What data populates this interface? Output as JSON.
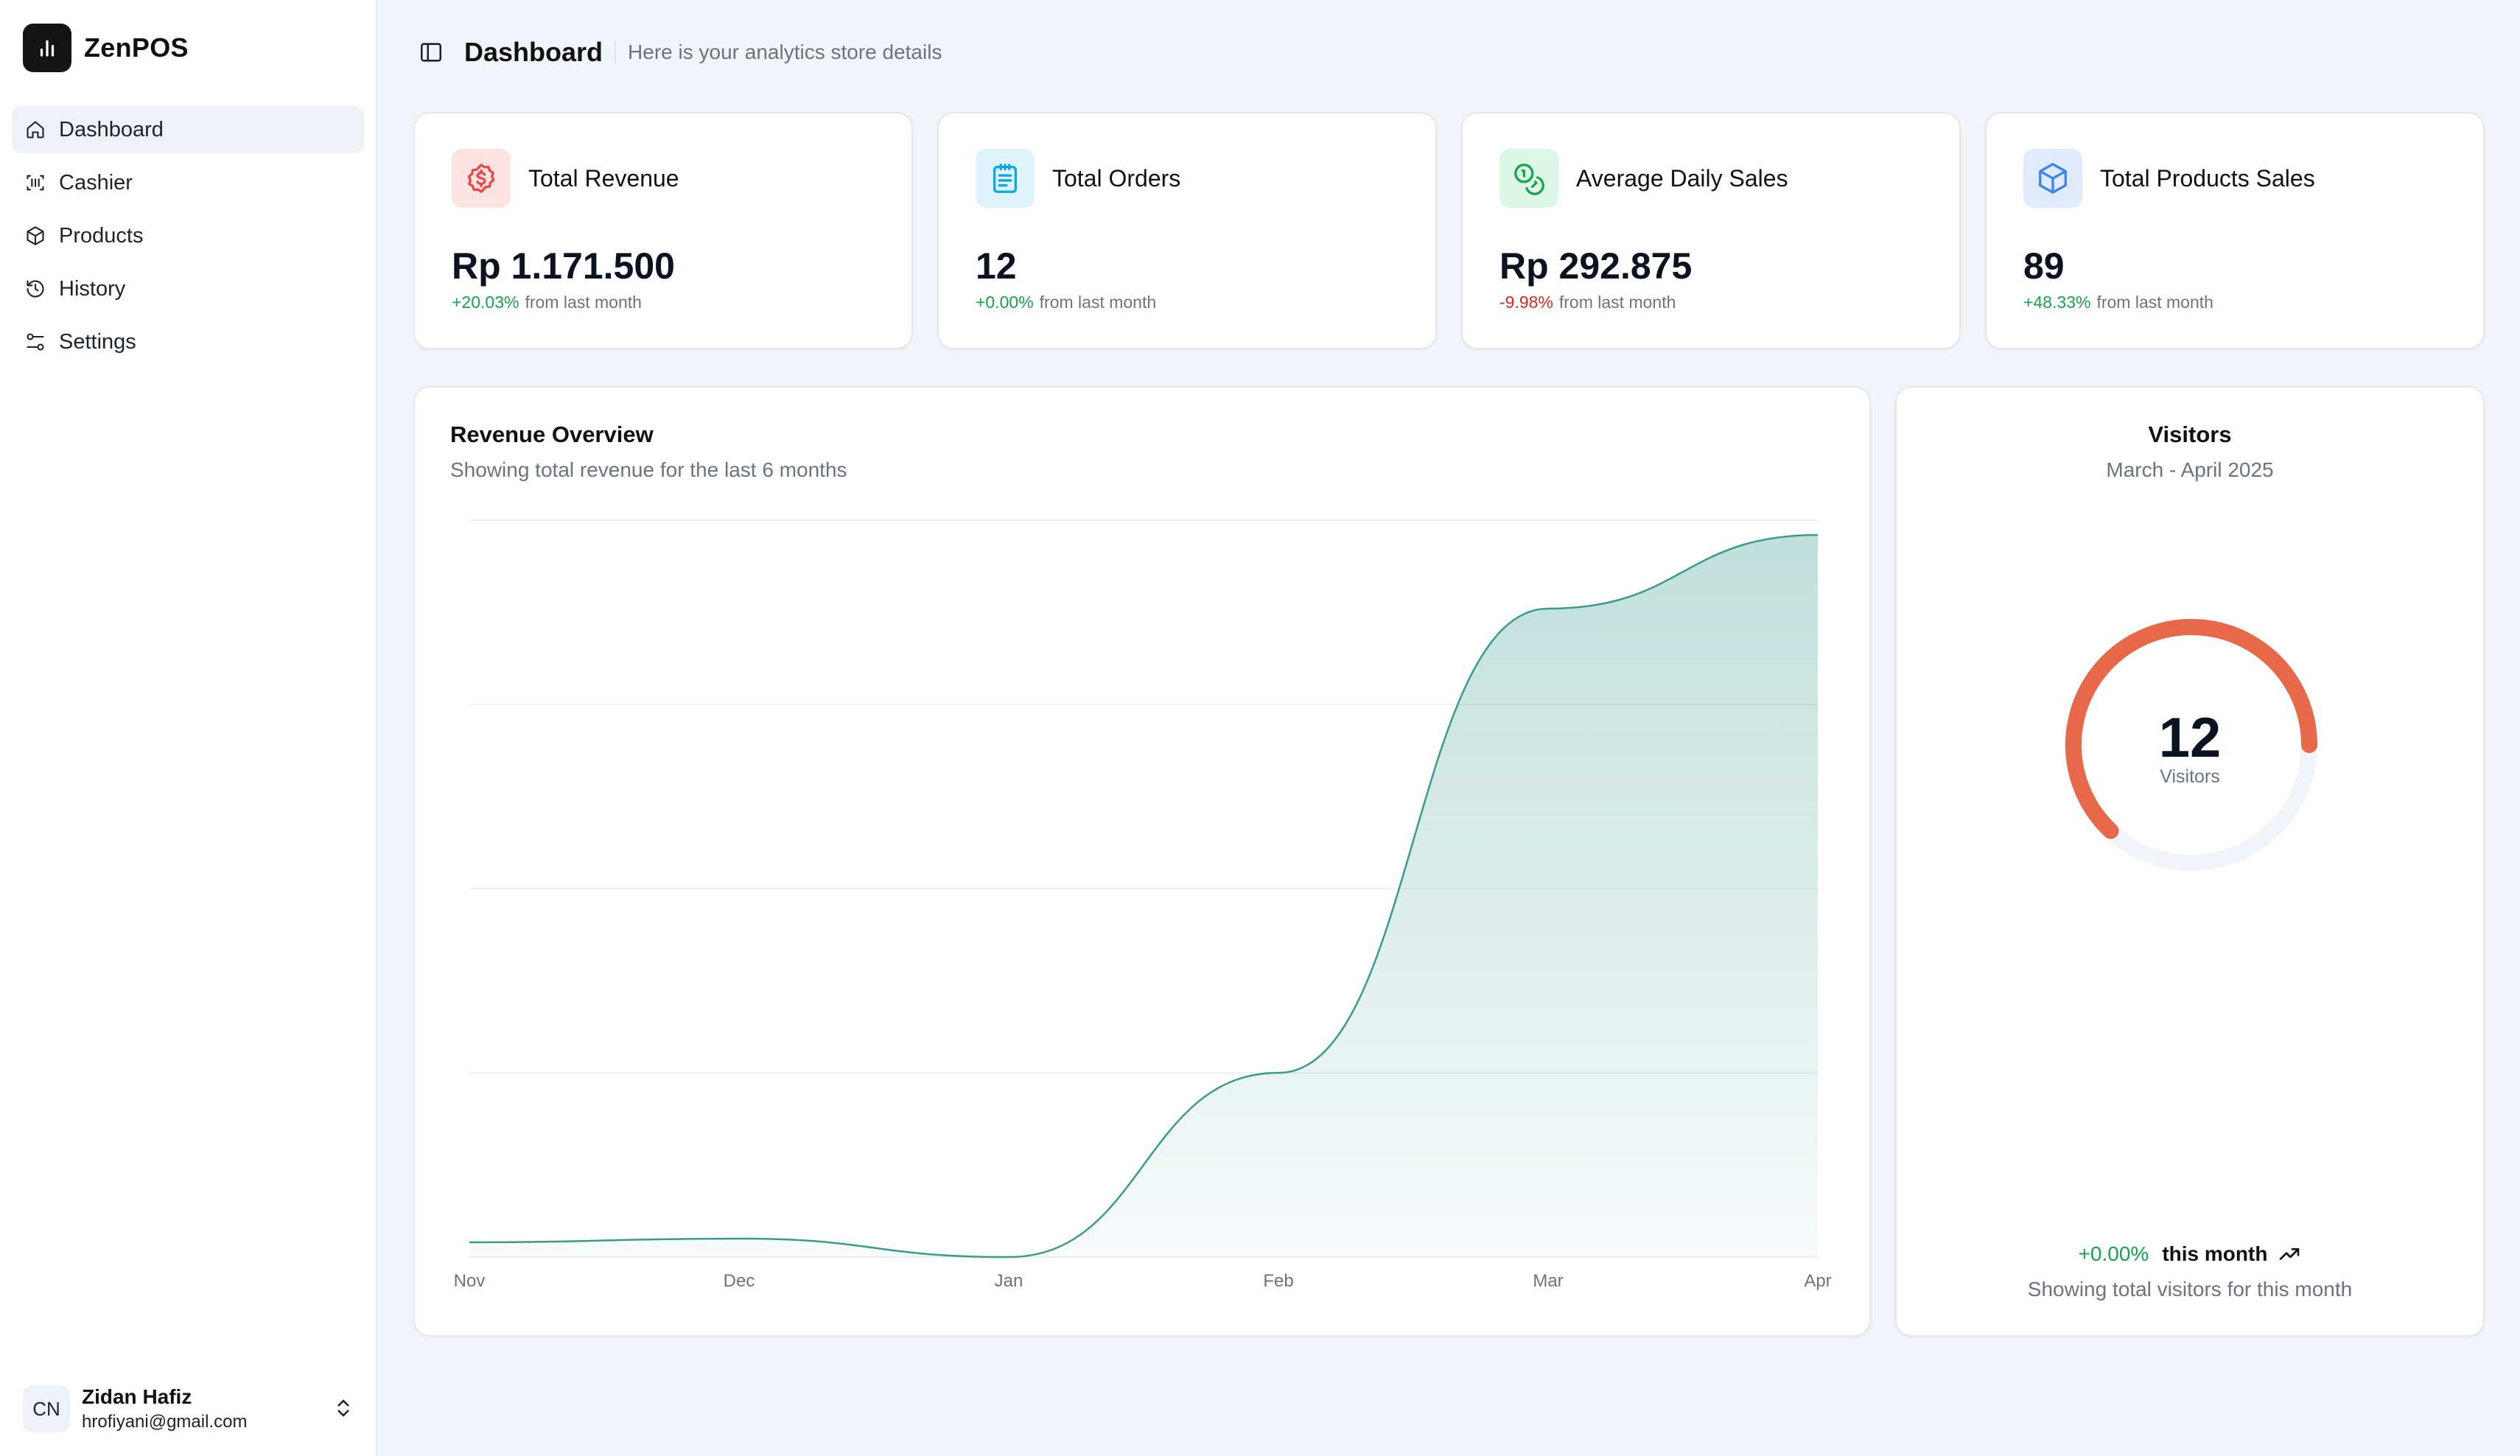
{
  "app": {
    "name": "ZenPOS"
  },
  "sidebar": {
    "items": [
      {
        "label": "Dashboard",
        "icon": "home-icon",
        "active": true
      },
      {
        "label": "Cashier",
        "icon": "scan-icon",
        "active": false
      },
      {
        "label": "Products",
        "icon": "box-icon",
        "active": false
      },
      {
        "label": "History",
        "icon": "history-icon",
        "active": false
      },
      {
        "label": "Settings",
        "icon": "sliders-icon",
        "active": false
      }
    ]
  },
  "user": {
    "initials": "CN",
    "name": "Zidan Hafiz",
    "email": "hrofiyani@gmail.com"
  },
  "header": {
    "title": "Dashboard",
    "subtitle": "Here is your analytics store details"
  },
  "stats": [
    {
      "label": "Total Revenue",
      "value": "Rp 1.171.500",
      "delta": "+20.03%",
      "delta_suffix": "from last month",
      "trend": "up",
      "icon": "dollar-badge-icon",
      "icon_color": "#ef4444",
      "icon_bg": "#fde2e2"
    },
    {
      "label": "Total Orders",
      "value": "12",
      "delta": "+0.00%",
      "delta_suffix": "from last month",
      "trend": "up",
      "icon": "clipboard-list-icon",
      "icon_color": "#0ea5e9",
      "icon_bg": "#dff3fc"
    },
    {
      "label": "Average Daily Sales",
      "value": "Rp 292.875",
      "delta": "-9.98%",
      "delta_suffix": "from last month",
      "trend": "down",
      "icon": "coins-icon",
      "icon_color": "#16a34a",
      "icon_bg": "#dcf7e6"
    },
    {
      "label": "Total Products Sales",
      "value": "89",
      "delta": "+48.33%",
      "delta_suffix": "from last month",
      "trend": "up",
      "icon": "box-icon",
      "icon_color": "#3b82f6",
      "icon_bg": "#e0ebfd"
    }
  ],
  "revenue": {
    "title": "Revenue Overview",
    "subtitle": "Showing total revenue for the last 6 months"
  },
  "chart_data": {
    "type": "area",
    "categories": [
      "Nov",
      "Dec",
      "Jan",
      "Feb",
      "Mar",
      "Apr"
    ],
    "values": [
      0.02,
      0.025,
      0.0,
      0.25,
      0.88,
      0.98
    ],
    "ylim": [
      0,
      1
    ],
    "grid": true,
    "color": "#3a9b8c",
    "title": "",
    "xlabel": "",
    "ylabel": ""
  },
  "visitors": {
    "title": "Visitors",
    "period": "March - April 2025",
    "value": "12",
    "label": "Visitors",
    "progress": 0.63,
    "color": "#e8694a",
    "delta": "+0.00%",
    "delta_text": "this month",
    "footer": "Showing total visitors for this month"
  }
}
